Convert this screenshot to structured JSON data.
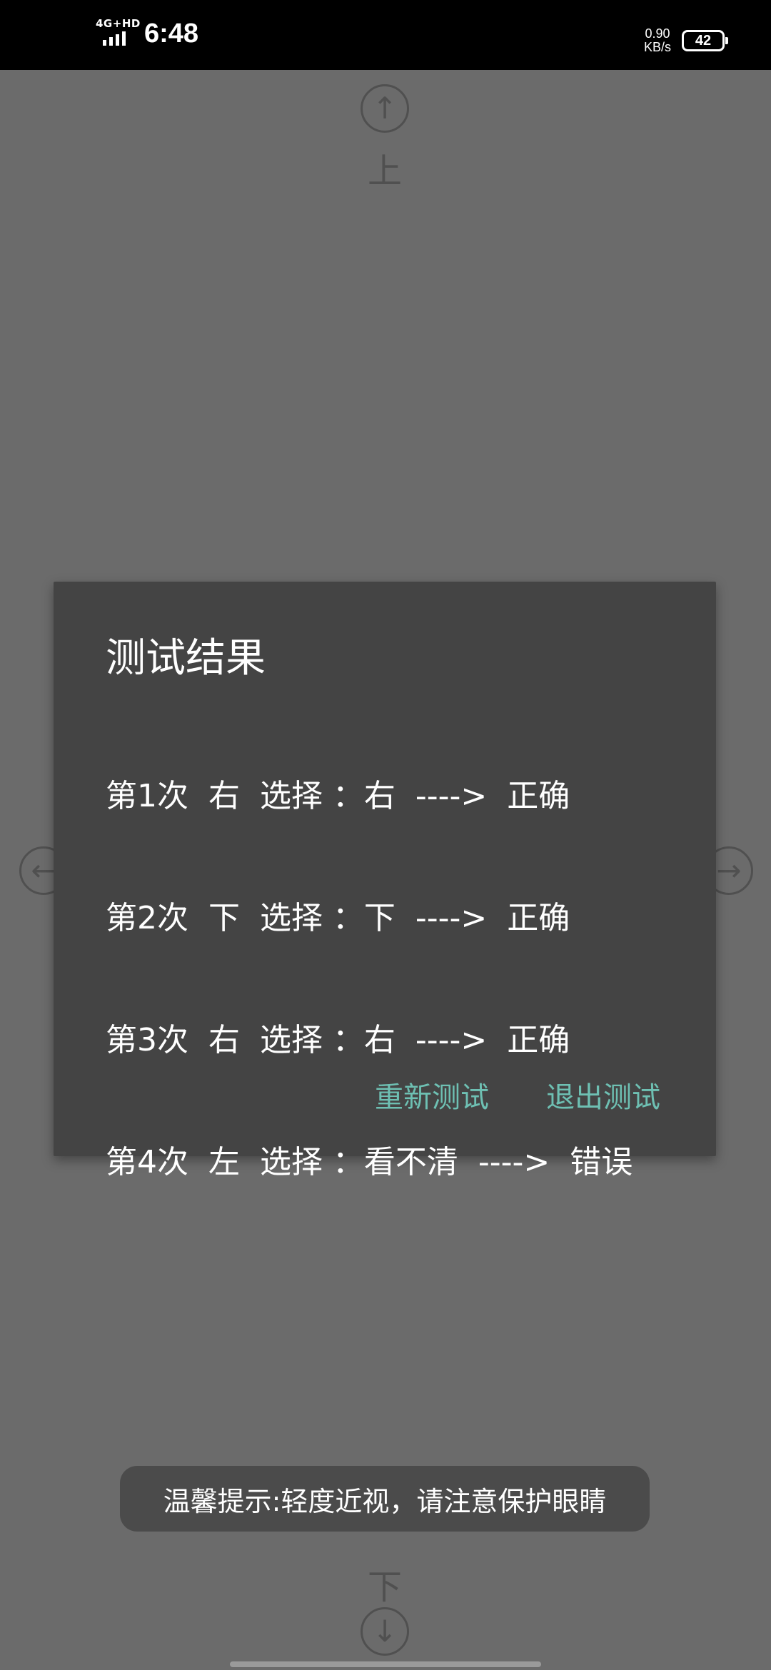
{
  "status_bar": {
    "network": "4G+HD",
    "time": "6:48",
    "speed_value": "0.90",
    "speed_unit": "KB/s",
    "battery": "42"
  },
  "background": {
    "up_label": "上",
    "down_label": "下",
    "icons": [
      "arrow-up-icon",
      "arrow-down-icon",
      "arrow-left-icon",
      "arrow-right-icon"
    ]
  },
  "dialog": {
    "title": "测试结果",
    "results": [
      "第1次  右  选择 ：右  ---->  正确",
      "第2次  下  选择 ：下  ---->  正确",
      "第3次  右  选择 ：右  ---->  正确",
      "第4次  左  选择 ：看不清  ---->  错误"
    ],
    "retest_label": "重新测试",
    "exit_label": "退出测试",
    "accent_color": "#6ec0b3"
  },
  "toast": {
    "text": "温馨提示:轻度近视，请注意保护眼睛"
  }
}
